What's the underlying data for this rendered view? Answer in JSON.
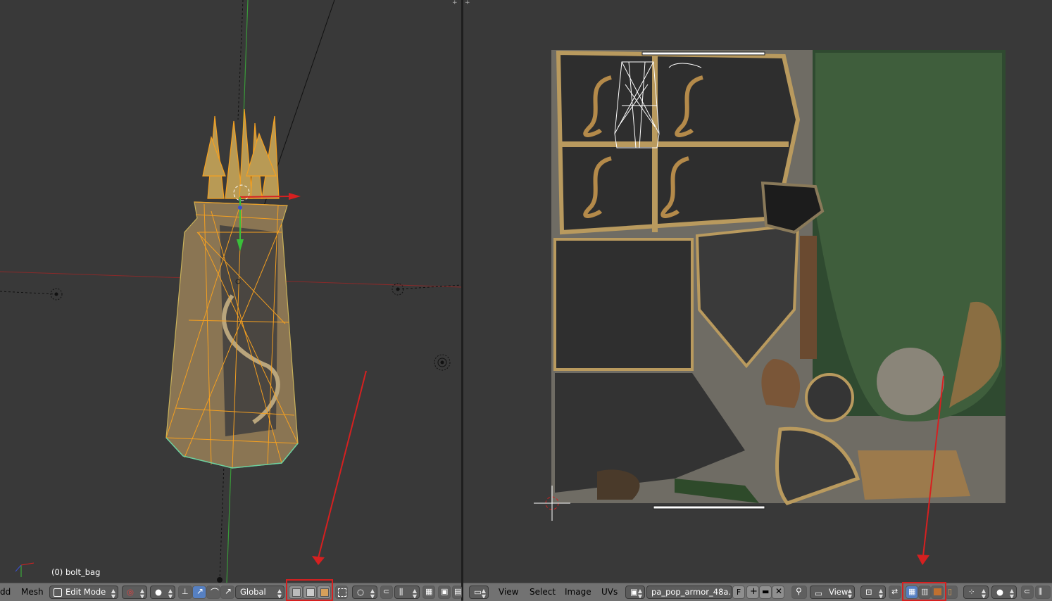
{
  "view3d": {
    "object_label": "(0) bolt_bag",
    "header": {
      "add_menu": "dd",
      "mesh_menu": "Mesh",
      "mode": "Edit Mode",
      "transform_orientation": "Global"
    }
  },
  "uv_editor": {
    "header": {
      "view_menu": "View",
      "select_menu": "Select",
      "image_menu": "Image",
      "uvs_menu": "UVs",
      "image_name": "pa_pop_armor_48a....",
      "fake_user": "F",
      "view_mode": "View"
    }
  },
  "colors": {
    "background": "#393939",
    "header": "#727272",
    "selection_orange": "#f5a020",
    "annotation_red": "#d62020"
  }
}
